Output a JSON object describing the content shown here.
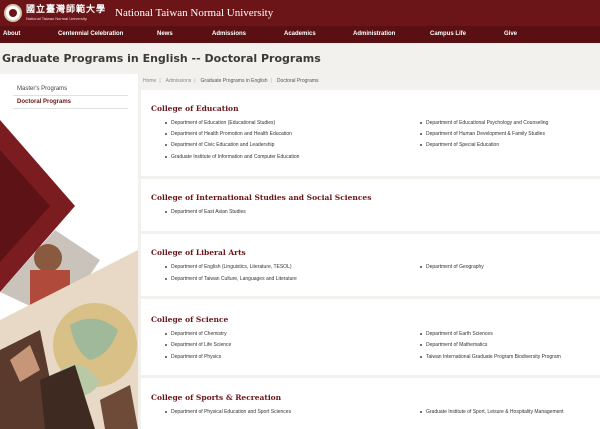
{
  "header": {
    "logo_cn": "國立臺灣師範大學",
    "logo_en": "National Taiwan Normal University",
    "site_name": "National Taiwan Normal University"
  },
  "nav": [
    "About",
    "Centennial Celebration",
    "News",
    "Admissions",
    "Academics",
    "Administration",
    "Campus Life",
    "Give"
  ],
  "page_title": "Graduate Programs in English -- Doctoral Programs",
  "sidebar": {
    "items": [
      {
        "label": "Master's Programs",
        "active": false
      },
      {
        "label": "Doctoral Programs",
        "active": true
      }
    ]
  },
  "breadcrumb": [
    "Home",
    "Admissions",
    "Graduate Programs in English",
    "Doctoral Programs"
  ],
  "colleges": [
    {
      "name": "College of Education",
      "left": [
        "Department of Education (Educational Studies)",
        "Department of Health Promotion and Health Education",
        "Department of Civic Education and Leadership",
        "Graduate Institute of Information and Computer Education"
      ],
      "right": [
        "Department of Educational Psychology and Counseling",
        "Department of Human Development & Family Studies",
        "Department of Special Education"
      ]
    },
    {
      "name": "College of International Studies and Social Sciences",
      "left": [
        "Department of East Asian Studies"
      ],
      "right": []
    },
    {
      "name": "College of Liberal Arts",
      "left": [
        "Department of English (Linguistics, Literature, TESOL)",
        "Department of Taiwan Culture, Languages and Literature"
      ],
      "right": [
        "Department of Geography"
      ]
    },
    {
      "name": "College of Science",
      "left": [
        "Department of Chemistry",
        "Department of Life Science",
        "Department of Physics"
      ],
      "right": [
        "Department of Earth Sciences",
        "Department of Mathematics",
        "Taiwan International Graduate Program Biodiversity Program"
      ]
    },
    {
      "name": "College of Sports & Recreation",
      "left": [
        "Department of Physical Education and Sport Sciences"
      ],
      "right": [
        "Graduate Institute of Sport, Leisure & Hospitality Management"
      ]
    }
  ],
  "colors": {
    "brand": "#6b1518",
    "nav": "#5a0f12"
  }
}
